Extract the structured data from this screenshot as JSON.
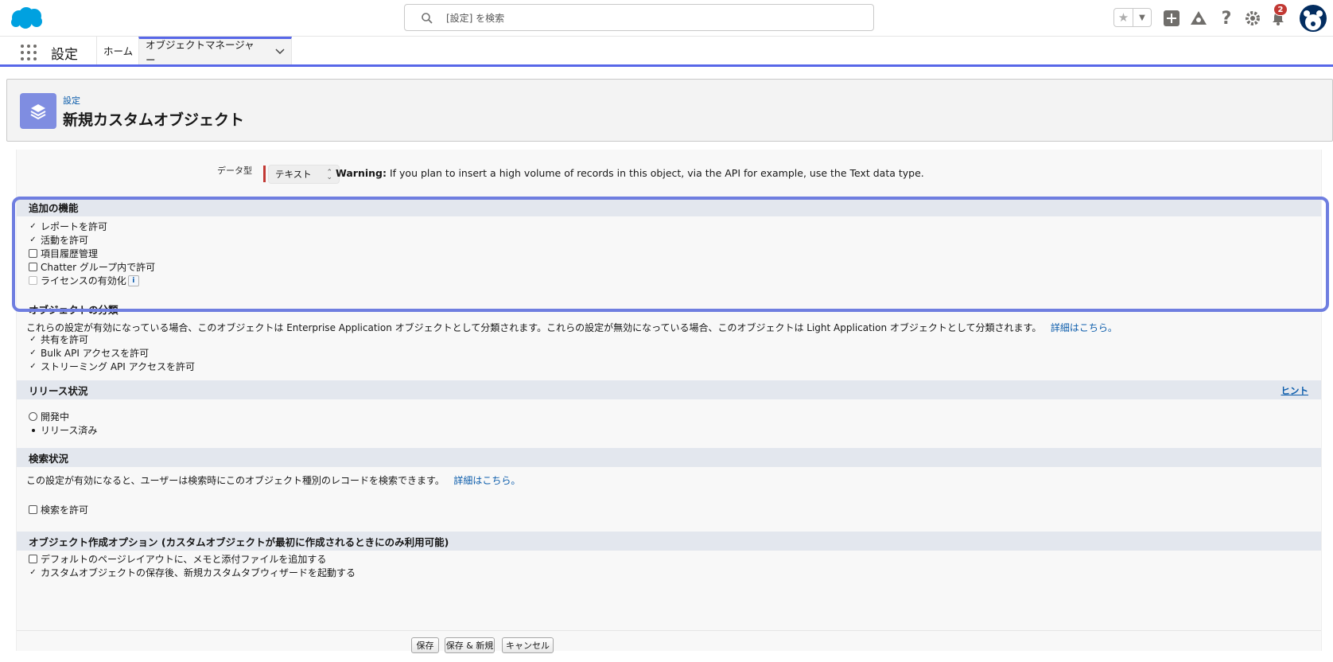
{
  "header": {
    "search_placeholder": "[設定] を検索",
    "notification_count": "2",
    "icons": [
      "salesforce-cloud-logo",
      "search-icon",
      "star-icon",
      "chevron-down-icon",
      "add-icon",
      "trailhead-icon",
      "help-icon",
      "gear-icon",
      "bell-icon",
      "avatar"
    ]
  },
  "nav": {
    "app_name": "設定",
    "tabs": [
      {
        "label": "ホーム"
      },
      {
        "label": "オブジェクトマネージャー"
      }
    ]
  },
  "page": {
    "breadcrumb": "設定",
    "title": "新規カスタムオブジェクト"
  },
  "datatype": {
    "label": "データ型",
    "value": "テキスト",
    "warning_bold": "Warning:",
    "warning_text": " If you plan to insert a high volume of records in this object, via the API for example, use the Text data type."
  },
  "features": {
    "title": "追加の機能",
    "items": [
      {
        "label": "レポートを許可",
        "state": "checked"
      },
      {
        "label": "活動を許可",
        "state": "checked"
      },
      {
        "label": "項目履歴管理",
        "state": "unchecked"
      },
      {
        "label": "Chatter グループ内で許可",
        "state": "unchecked"
      },
      {
        "label": "ライセンスの有効化",
        "state": "disabled",
        "info": "i"
      }
    ]
  },
  "classification": {
    "title": "オブジェクトの分類",
    "description": "これらの設定が有効になっている場合、このオブジェクトは Enterprise Application オブジェクトとして分類されます。これらの設定が無効になっている場合、このオブジェクトは Light Application オブジェクトとして分類されます。",
    "link": "詳細はこちら。",
    "items": [
      {
        "label": "共有を許可",
        "state": "checked"
      },
      {
        "label": "Bulk API アクセスを許可",
        "state": "checked"
      },
      {
        "label": "ストリーミング API アクセスを許可",
        "state": "checked"
      }
    ]
  },
  "release": {
    "title": "リリース状況",
    "hint": "ヒント",
    "items": [
      {
        "label": "開発中",
        "state": "unselected"
      },
      {
        "label": "リリース済み",
        "state": "selected"
      }
    ]
  },
  "search_status": {
    "title": "検索状況",
    "description": "この設定が有効になると、ユーザーは検索時にこのオブジェクト種別のレコードを検索できます。",
    "link": "詳細はこちら。",
    "items": [
      {
        "label": "検索を許可",
        "state": "unchecked"
      }
    ]
  },
  "creation_options": {
    "title": "オブジェクト作成オプション (カスタムオブジェクトが最初に作成されるときにのみ利用可能)",
    "items": [
      {
        "label": "デフォルトのページレイアウトに、メモと添付ファイルを追加する",
        "state": "unchecked"
      },
      {
        "label": "カスタムオブジェクトの保存後、新規カスタムタブウィザードを起動する",
        "state": "checked"
      }
    ]
  },
  "buttons": {
    "save": "保存",
    "save_new": "保存 & 新規",
    "cancel": "キャンセル"
  },
  "colors": {
    "brand": "#00a1e0",
    "accent": "#5867e8",
    "link": "#0b5cab",
    "required": "#c23934"
  }
}
